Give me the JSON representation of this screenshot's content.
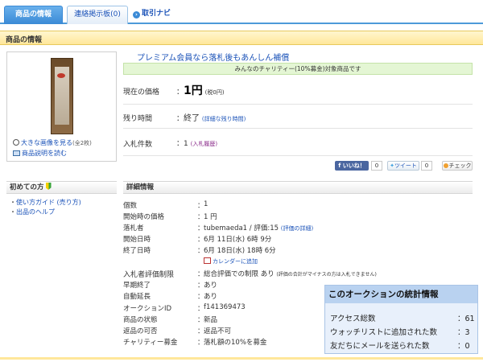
{
  "tabs": [
    {
      "label": "商品の情報"
    },
    {
      "label": "連絡掲示板(0)"
    },
    {
      "label": "取引ナビ"
    }
  ],
  "section_title": "商品の情報",
  "image_links": {
    "large_image": "大きな画像を見る",
    "large_image_count": "(全2枚)",
    "description": "商品説明を読む"
  },
  "premium_link": "プレミアム会員なら落札後もあんしん補償",
  "charity_text": "みんなのチャリティー(10%募金)対象商品です",
  "price": {
    "label": "現在の価格",
    "value": "1円",
    "tax": "(税0円)"
  },
  "remaining": {
    "label": "残り時間",
    "value": "終了",
    "detail_link": "(詳細な残り時間)"
  },
  "bids": {
    "label": "入札件数",
    "value": "1",
    "history_link": "(入札履歴)"
  },
  "social": {
    "facebook": "f いいね！",
    "facebook_count": "0",
    "tweet": "ツイート",
    "tweet_count": "0",
    "check": "チェック"
  },
  "beginner": {
    "title": "初めての方",
    "links": [
      "使い方ガイド (売り方)",
      "出品のヘルプ"
    ]
  },
  "detail": {
    "title": "詳細情報",
    "rows": [
      {
        "label": "個数",
        "value": "1"
      },
      {
        "label": "開始時の価格",
        "value": "1 円"
      },
      {
        "label": "落札者",
        "value": "tubemaeda1 / 評価:15",
        "link": "(評価の詳細)"
      },
      {
        "label": "開始日時",
        "value": "6月 11日(水) 6時 9分"
      },
      {
        "label": "終了日時",
        "value": "6月 18日(水) 18時 6分"
      },
      {
        "label": "",
        "value": "",
        "calendar": "カレンダーに追加"
      },
      {
        "label": "入札者評価制限",
        "value": "総合評価での制限 あり",
        "note": "(評価の合計がマイナスの方は入札できません)"
      },
      {
        "label": "早期終了",
        "value": "あり"
      },
      {
        "label": "自動延長",
        "value": "あり"
      },
      {
        "label": "オークションID",
        "value": "f141369473"
      },
      {
        "label": "商品の状態",
        "value": "新品"
      },
      {
        "label": "返品の可否",
        "value": "返品不可"
      },
      {
        "label": "チャリティー募金",
        "value": "落札額の10%を募金"
      }
    ],
    "separator": "："
  },
  "stats": {
    "title": "このオークションの統計情報",
    "rows": [
      {
        "label": "アクセス総数",
        "value": "61"
      },
      {
        "label": "ウォッチリストに追加された数",
        "value": "3"
      },
      {
        "label": "友だちにメールを送られた数",
        "value": "0"
      }
    ],
    "separator": "："
  }
}
